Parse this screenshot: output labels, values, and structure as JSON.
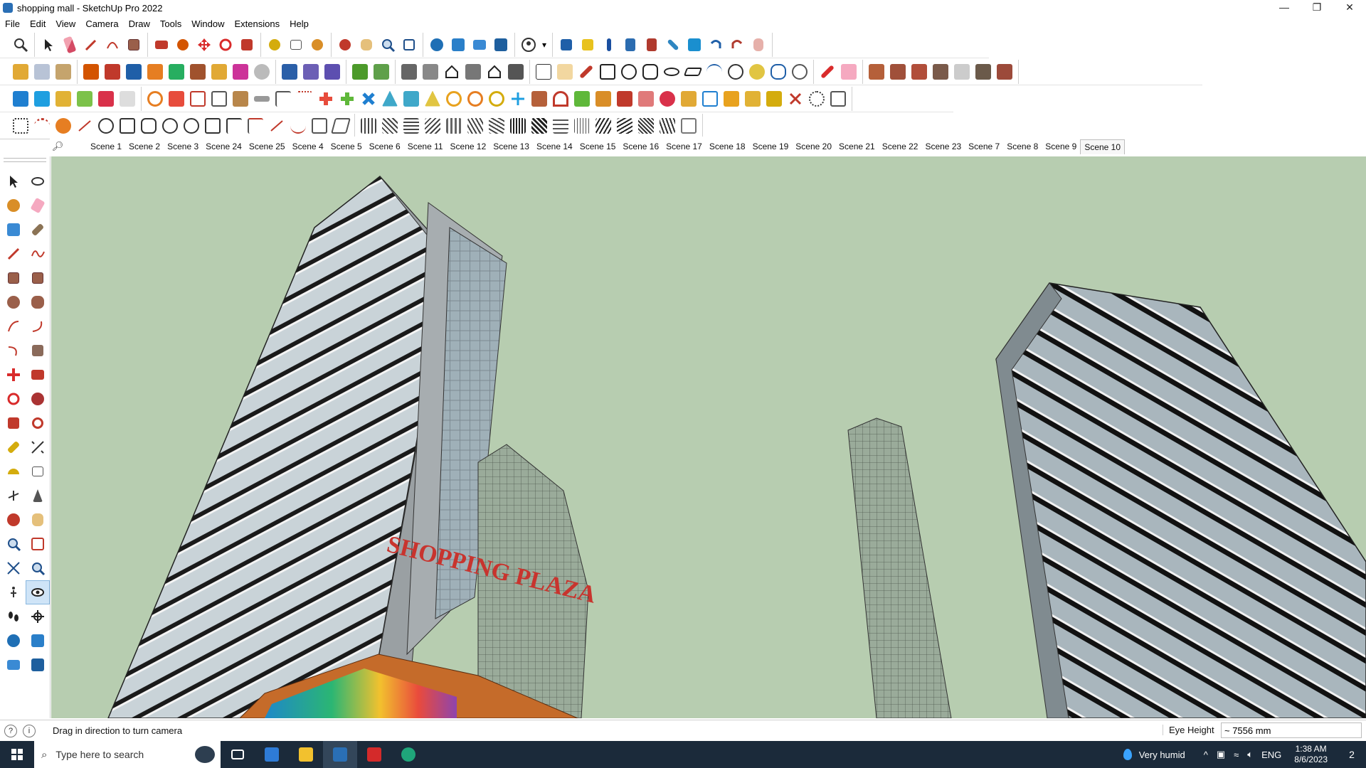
{
  "window": {
    "title": "shopping mall - SketchUp Pro 2022",
    "controls": [
      "—",
      "❐",
      "✕"
    ]
  },
  "menu": [
    "File",
    "Edit",
    "View",
    "Camera",
    "Draw",
    "Tools",
    "Window",
    "Extensions",
    "Help"
  ],
  "scenes": {
    "search_icon": "search-icon",
    "tabs": [
      "Scene 1",
      "Scene 2",
      "Scene 3",
      "Scene 24",
      "Scene 25",
      "Scene 4",
      "Scene 5",
      "Scene 6",
      "Scene 11",
      "Scene 12",
      "Scene 13",
      "Scene 14",
      "Scene 15",
      "Scene 16",
      "Scene 17",
      "Scene 18",
      "Scene 19",
      "Scene 20",
      "Scene 21",
      "Scene 22",
      "Scene 23",
      "Scene 7",
      "Scene 8",
      "Scene 9",
      "Scene 10"
    ],
    "active": "Scene 10"
  },
  "model": {
    "sign_text": "SHOPPING PLAZA"
  },
  "status": {
    "hint": "Drag in direction to turn camera",
    "measure_label": "Eye Height",
    "measure_value": "~ 7556 mm"
  },
  "taskbar": {
    "search_placeholder": "Type here to search",
    "weather": "Very humid",
    "language": "ENG",
    "time": "1:38 AM",
    "date": "8/6/2023",
    "notifications": "2"
  },
  "colors": {
    "viewport_sky": "#b7cdb0",
    "taskbar": "#1b2a3a",
    "sign_red": "#c8342e"
  }
}
